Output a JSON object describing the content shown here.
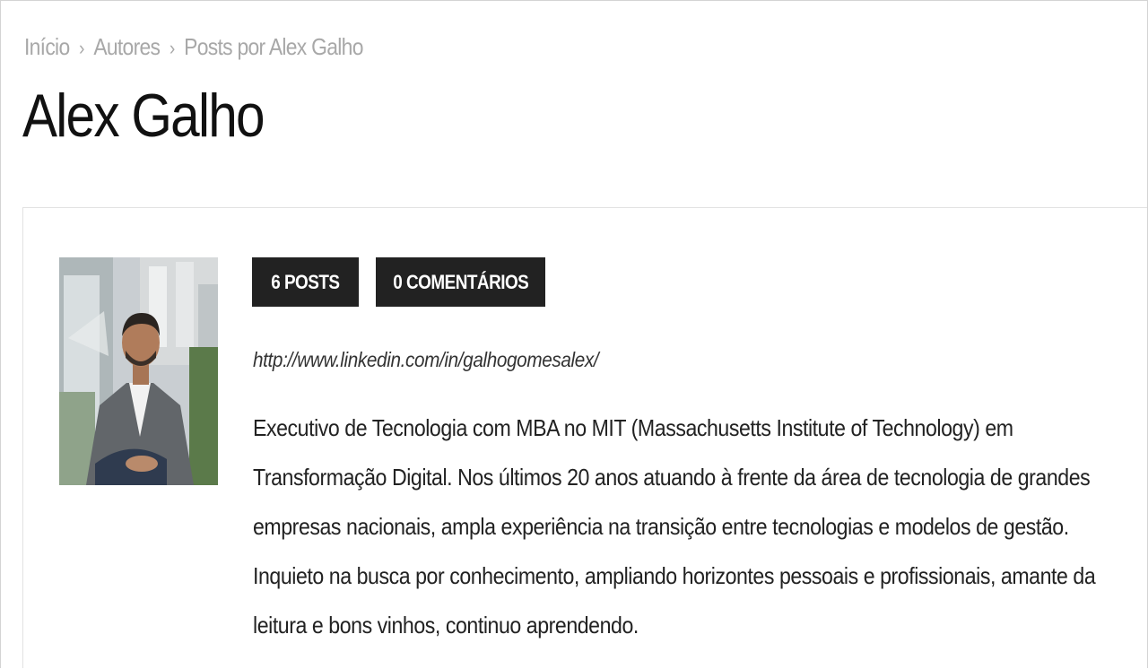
{
  "breadcrumb": {
    "items": [
      {
        "label": "Início"
      },
      {
        "label": "Autores"
      },
      {
        "label": "Posts por Alex Galho"
      }
    ],
    "separator": "›"
  },
  "page": {
    "title": "Alex Galho"
  },
  "author": {
    "posts_label": "6 POSTS",
    "comments_label": "0 COMENTÁRIOS",
    "url": "http://www.linkedin.com/in/galhogomesalex/",
    "bio": "Executivo de Tecnologia com MBA no MIT (Massachusetts Institute of Technology) em Transformação Digital. Nos últimos 20 anos atuando à frente da área de tecnologia de grandes empresas nacionais, ampla experiência na transição entre tecnologias e modelos de gestão. Inquieto na busca por conhecimento, ampliando horizontes pessoais e profissionais, amante da leitura e bons vinhos, continuo aprendendo."
  },
  "colors": {
    "badge_bg": "#222222",
    "badge_text": "#ffffff",
    "breadcrumb_text": "#a8a8a8",
    "title_text": "#111111"
  }
}
